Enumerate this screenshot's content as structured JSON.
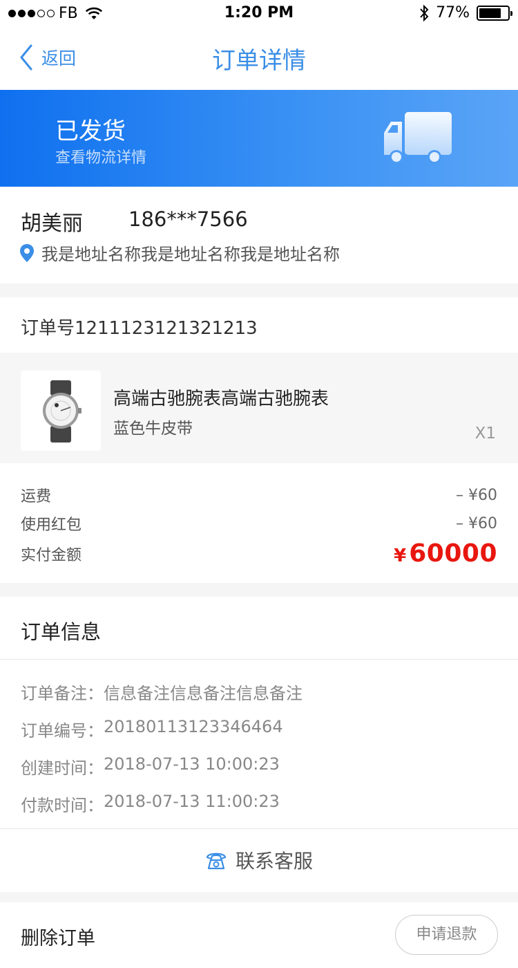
{
  "status_bar": {
    "carrier": "FB",
    "time": "1:20 PM",
    "battery": "77%",
    "battery_level": 0.77
  },
  "nav": {
    "back_label": "返回",
    "title": "订单详情"
  },
  "banner": {
    "title": "已发货",
    "subtitle": "查看物流详情"
  },
  "address": {
    "name": "胡美丽",
    "phone": "186***7566",
    "address": "我是地址名称我是地址名称我是地址名称"
  },
  "order": {
    "order_no": "订单号1211123121321213",
    "product": {
      "name": "高端古驰腕表高端古驰腕表",
      "spec": "蓝色牛皮带",
      "qty": "X1"
    },
    "fees": [
      {
        "label": "运费",
        "value": "– ¥60"
      },
      {
        "label": "使用红包",
        "value": "– ¥60"
      }
    ],
    "total": {
      "label": "实付金额",
      "currency": "¥",
      "amount": "60000"
    }
  },
  "info": {
    "title": "订单信息",
    "rows": [
      {
        "label": "订单备注：",
        "value": "信息备注信息备注信息备注"
      },
      {
        "label": "订单编号：",
        "value": "20180113123346464"
      },
      {
        "label": "创建时间：",
        "value": "2018-07-13 10:00:23"
      },
      {
        "label": "付款时间：",
        "value": "2018-07-13 11:00:23"
      }
    ],
    "contact_label": "联系客服"
  },
  "actions": {
    "delete_label": "删除订单",
    "refund_label": "申请退款"
  },
  "colors": {
    "accent": "#3a8ee6",
    "banner_start": "#0f70ef",
    "banner_end": "#5aa4f7",
    "price": "#e8170f"
  },
  "icons": {
    "signal": "signal-dots-icon",
    "wifi": "wifi-icon",
    "bluetooth": "bluetooth-icon",
    "battery": "battery-icon",
    "back": "chevron-left-icon",
    "truck": "truck-icon",
    "location": "location-pin-icon",
    "phone": "phone-icon"
  }
}
